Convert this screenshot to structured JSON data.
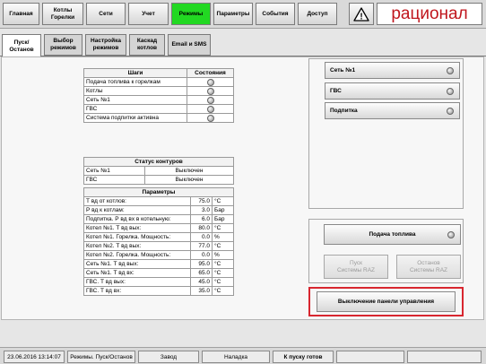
{
  "nav": {
    "items": [
      {
        "label": "Главная"
      },
      {
        "label": "Котлы Горелки"
      },
      {
        "label": "Сети"
      },
      {
        "label": "Учет"
      },
      {
        "label": "Режимы"
      },
      {
        "label": "Параметры"
      },
      {
        "label": "События"
      },
      {
        "label": "Доступ"
      }
    ],
    "active": "Режимы",
    "active_color": "#22d822",
    "warning_icon": "warning-triangle-icon",
    "warning_glyph": "!",
    "logo_text": "рационал",
    "logo_color": "#c0161d"
  },
  "subtabs": {
    "items": [
      {
        "label": "Пуск/Останов"
      },
      {
        "label": "Выбор режимов"
      },
      {
        "label": "Настройка режимов"
      },
      {
        "label": "Каскад котлов"
      },
      {
        "label": "Email и SMS"
      }
    ],
    "active": "Пуск/Останов"
  },
  "steps_table": {
    "col_step": "Шаги",
    "col_state": "Состояния",
    "rows": [
      {
        "name": "Подача топлива к горелкам"
      },
      {
        "name": "Котлы"
      },
      {
        "name": "Сеть №1"
      },
      {
        "name": "ГВС"
      },
      {
        "name": "Система подпитки активна"
      }
    ]
  },
  "contours_table": {
    "title": "Статус контуров",
    "rows": [
      {
        "name": "Сеть №1",
        "status": "Выключен"
      },
      {
        "name": "ГВС",
        "status": "Выключен"
      }
    ]
  },
  "params_table": {
    "title": "Параметры",
    "rows": [
      {
        "name": "Т вд от котлов:",
        "value": "75.0",
        "unit": "°С"
      },
      {
        "name": "Р вд к котлам:",
        "value": "3.0",
        "unit": "Бар"
      },
      {
        "name": "Подпитка. Р вд вх в котельную:",
        "value": "6.0",
        "unit": "Бар"
      },
      {
        "name": "Котел №1. Т вд вых:",
        "value": "80.0",
        "unit": "°С"
      },
      {
        "name": "Котел №1. Горелка. Мощность:",
        "value": "0.0",
        "unit": "%"
      },
      {
        "name": "Котел №2. Т вд вых:",
        "value": "77.0",
        "unit": "°С"
      },
      {
        "name": "Котел №2. Горелка. Мощность:",
        "value": "0.0",
        "unit": "%"
      },
      {
        "name": "Сеть №1. Т вд вых:",
        "value": "95.0",
        "unit": "°С"
      },
      {
        "name": "Сеть №1. Т вд вх:",
        "value": "65.0",
        "unit": "°С"
      },
      {
        "name": "ГВС. Т вд вых:",
        "value": "45.0",
        "unit": "°С"
      },
      {
        "name": "ГВС. Т вд вх:",
        "value": "35.0",
        "unit": "°С"
      }
    ]
  },
  "right_top": {
    "buttons": [
      {
        "label": "Сеть №1"
      },
      {
        "label": "ГВС"
      },
      {
        "label": "Подпитка"
      }
    ]
  },
  "right_bottom": {
    "fuel_label": "Подача топлива",
    "start_label_1": "Пуск",
    "start_label_2": "Системы RAZ",
    "stop_label_1": "Останов",
    "stop_label_2": "Системы RAZ"
  },
  "shutdown": {
    "label": "Выключение панели управления",
    "border_color": "#d8262f"
  },
  "status_bar": {
    "datetime": "23.06.2016 13:14:07",
    "mode": "Режимы. Пуск/Останов",
    "site": "Завод",
    "user": "Наладка",
    "ready": "К пуску готов"
  }
}
